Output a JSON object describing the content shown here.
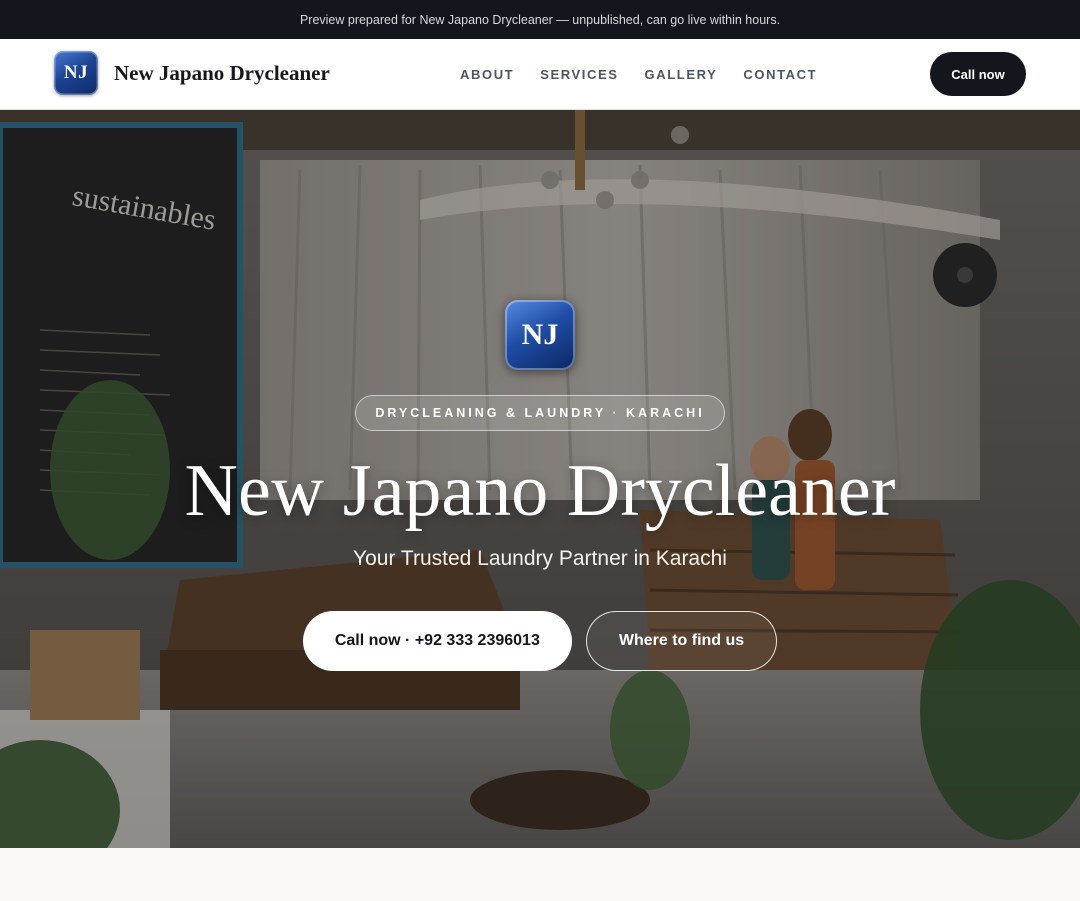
{
  "banner": {
    "text": "Preview prepared for New Japano Drycleaner — unpublished, can go live within hours."
  },
  "header": {
    "logo_text": "NJ",
    "brand_name": "New Japano Drycleaner",
    "nav": [
      {
        "label": "ABOUT"
      },
      {
        "label": "SERVICES"
      },
      {
        "label": "GALLERY"
      },
      {
        "label": "CONTACT"
      }
    ],
    "call_label": "Call now"
  },
  "hero": {
    "logo_text": "NJ",
    "tagline": "DRYCLEANING & LAUNDRY · KARACHI",
    "title": "New Japano Drycleaner",
    "subtitle": "Your Trusted Laundry Partner in Karachi",
    "primary_cta": "Call now · +92 333 2396013",
    "secondary_cta": "Where to find us",
    "chalkboard_text": "sustainables"
  },
  "colors": {
    "dark": "#13161c",
    "brand_blue": "#1d4494",
    "page_bg": "#faf9f6"
  }
}
